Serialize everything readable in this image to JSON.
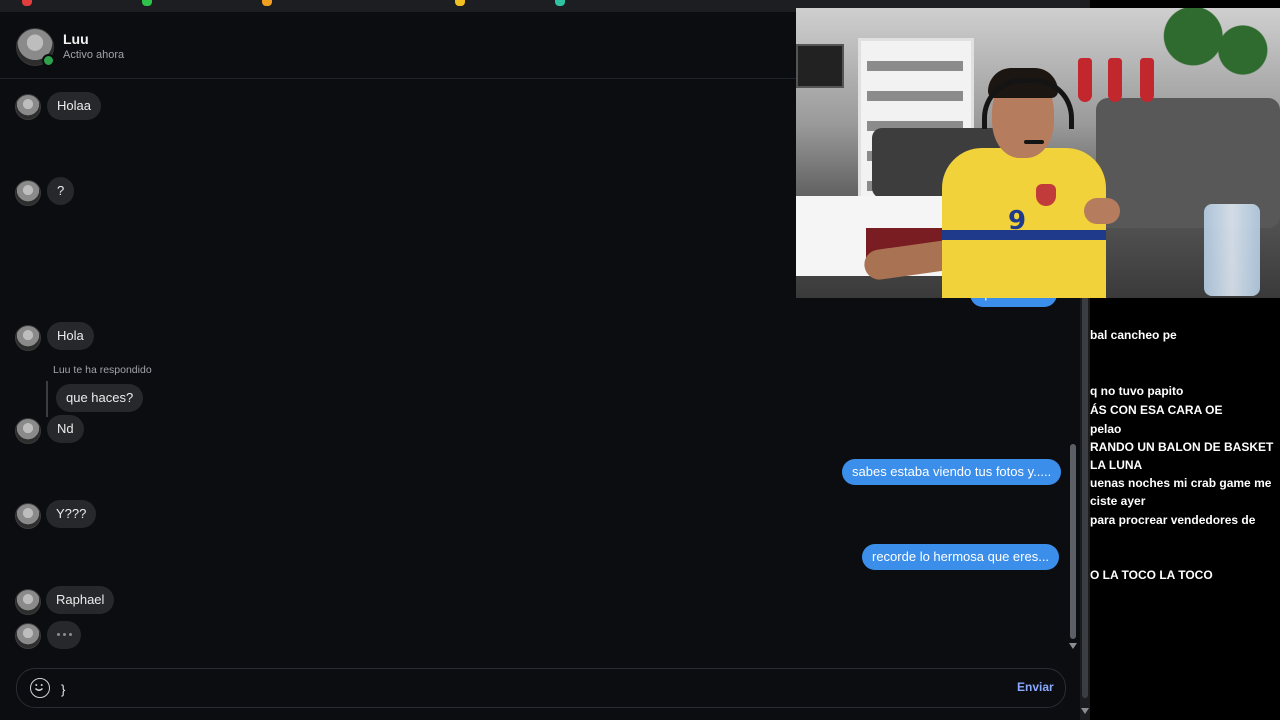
{
  "contact": {
    "name": "Luu",
    "status": "Activo ahora"
  },
  "messages": {
    "in_1": "Holaa",
    "in_2": "?",
    "in_3": "Hola",
    "reply_note": "Luu te ha respondido",
    "reply_quote": "que haces?",
    "in_4": "Nd",
    "in_5": "Y???",
    "in_6": "Raphael",
    "out_1": "que haces?",
    "out_2": "sabes estaba viendo tus fotos y.....",
    "out_3": "recorde lo hermosa que eres..."
  },
  "composer": {
    "value": "}",
    "send_label": "Enviar"
  },
  "stream_chat": [
    "bal cancheo pe",
    "q no tuvo papito",
    "ÁS CON ESA CARA OE",
    "pelao",
    "RANDO UN BALON DE BASKET",
    "LA LUNA",
    "uenas noches mi crab game me",
    "ciste ayer",
    "para procrear vendedores de",
    "O LA TOCO LA TOCO"
  ],
  "webcam": {
    "jersey_number": "9"
  },
  "colors": {
    "outgoing": "#3b8eea",
    "incoming": "#26282c",
    "online": "#31a24c",
    "send": "#8aa8ff"
  },
  "icons": {
    "emoji": "smiley-icon",
    "online": "online-dot-icon"
  }
}
